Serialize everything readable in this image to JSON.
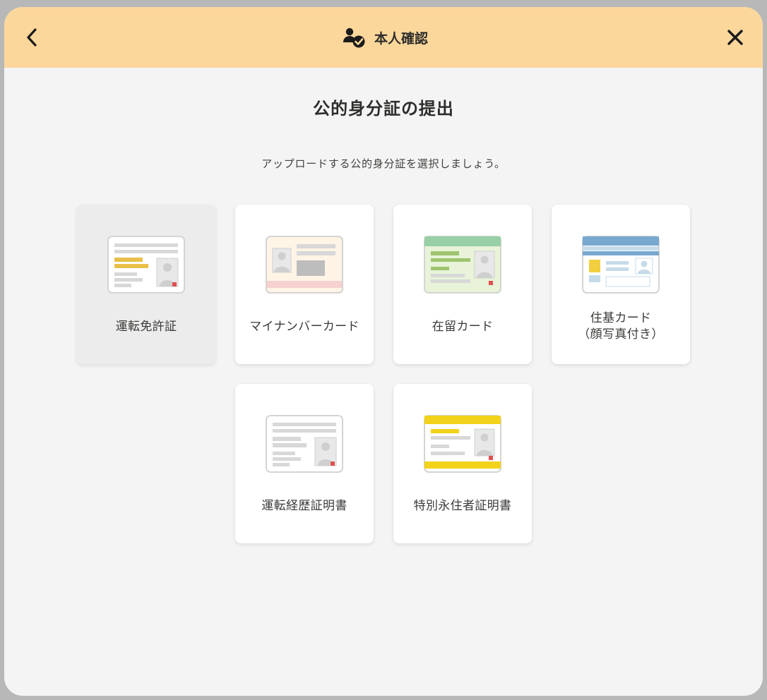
{
  "header": {
    "title": "本人確認"
  },
  "page": {
    "title": "公的身分証の提出",
    "subtitle": "アップロードする公的身分証を選択しましょう。"
  },
  "documents": [
    {
      "id": "drivers-license",
      "label": "運転免許証"
    },
    {
      "id": "my-number-card",
      "label": "マイナンバーカード"
    },
    {
      "id": "residence-card",
      "label": "在留カード"
    },
    {
      "id": "basic-resident-card",
      "label": "住基カード\n（顔写真付き）"
    },
    {
      "id": "driving-history-cert",
      "label": "運転経歴証明書"
    },
    {
      "id": "special-permanent-resident-cert",
      "label": "特別永住者証明書"
    }
  ],
  "selected_index": 0
}
